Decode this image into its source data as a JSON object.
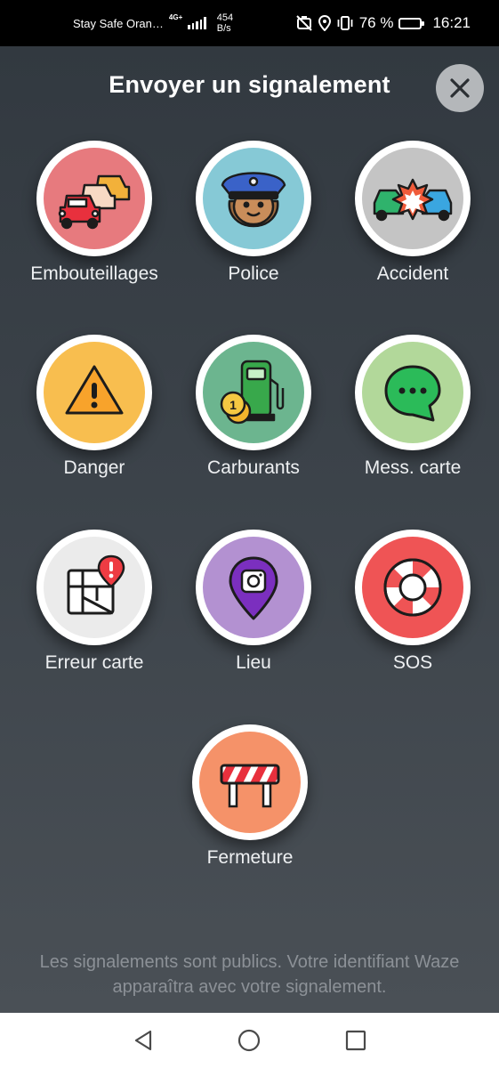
{
  "status_bar": {
    "carrier": "Stay Safe Oran…",
    "network": "4G+",
    "speed_value": "454",
    "speed_unit": "B/s",
    "battery": "76 %",
    "battery_level": 0.76,
    "time": "16:21"
  },
  "header": {
    "title": "Envoyer un signalement",
    "close_icon": "close-icon"
  },
  "reports": [
    {
      "label": "Embouteillages",
      "icon": "traffic-jam-icon",
      "color": "#e77a7e"
    },
    {
      "label": "Police",
      "icon": "police-icon",
      "color": "#86c9d6"
    },
    {
      "label": "Accident",
      "icon": "accident-icon",
      "color": "#c4c4c4"
    },
    {
      "label": "Danger",
      "icon": "hazard-icon",
      "color": "#f8be4f"
    },
    {
      "label": "Carburants",
      "icon": "fuel-icon",
      "color": "#6cb58f"
    },
    {
      "label": "Mess. carte",
      "icon": "map-chat-icon",
      "color": "#b2d89a"
    },
    {
      "label": "Erreur carte",
      "icon": "map-error-icon",
      "color": "#ebebeb"
    },
    {
      "label": "Lieu",
      "icon": "place-icon",
      "color": "#b391d1"
    },
    {
      "label": "SOS",
      "icon": "sos-icon",
      "color": "#ef5455"
    },
    {
      "label": "Fermeture",
      "icon": "road-closure-icon",
      "color": "#f59269"
    }
  ],
  "footer_text": "Les signalements sont publics. Votre identifiant Waze apparaîtra avec votre signalement.",
  "nav": {
    "back": "back-icon",
    "home": "home-icon",
    "recents": "recents-icon"
  }
}
